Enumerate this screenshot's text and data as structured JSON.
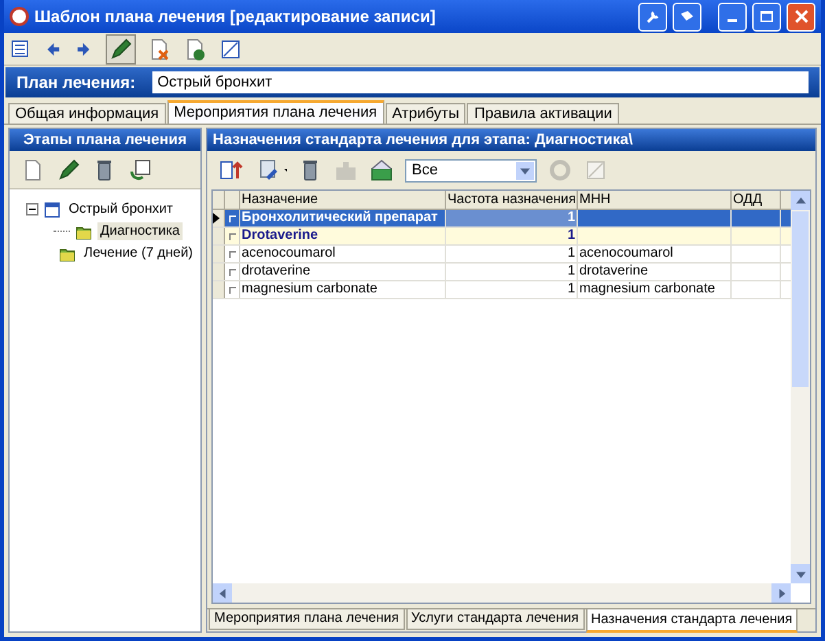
{
  "window": {
    "title": "Шаблон плана лечения [редактирование записи]"
  },
  "plan": {
    "label": "План лечения:",
    "value": "Острый бронхит"
  },
  "tabs": [
    {
      "label": "Общая информация",
      "selected": false
    },
    {
      "label": "Мероприятия плана лечения",
      "selected": true
    },
    {
      "label": "Атрибуты",
      "selected": false
    },
    {
      "label": "Правила активации",
      "selected": false
    }
  ],
  "stages_panel": {
    "title": "Этапы плана лечения",
    "tree": [
      {
        "label": "Острый бронхит",
        "expanded": true,
        "selected": false,
        "children": [
          {
            "label": "Диагностика",
            "selected": true
          },
          {
            "label": "Лечение (7 дней)",
            "selected": false
          }
        ]
      }
    ]
  },
  "prescriptions_panel": {
    "title": "Назначения стандарта лечения для этапа: Диагностика\\",
    "filter": "Все",
    "table": {
      "columns": [
        "Назначение",
        "Частота назначения",
        "МНН",
        "ОДД"
      ],
      "rows": [
        {
          "cells": [
            "Бронхолитический препарат",
            "1",
            ""
          ],
          "selected": true,
          "group": true
        },
        {
          "cells": [
            "Drotaverine",
            "1",
            ""
          ],
          "selected": false,
          "group": true
        },
        {
          "cells": [
            "acenocoumarol",
            "1",
            "acenocoumarol"
          ],
          "selected": false,
          "group": false
        },
        {
          "cells": [
            "drotaverine",
            "1",
            "drotaverine"
          ],
          "selected": false,
          "group": false
        },
        {
          "cells": [
            "magnesium carbonate",
            "1",
            "magnesium carbonate"
          ],
          "selected": false,
          "group": false
        }
      ]
    }
  },
  "bottom_tabs": [
    {
      "label": "Мероприятия плана лечения",
      "selected": false
    },
    {
      "label": "Услуги стандарта лечения",
      "selected": false
    },
    {
      "label": "Назначения стандарта лечения",
      "selected": true
    }
  ]
}
